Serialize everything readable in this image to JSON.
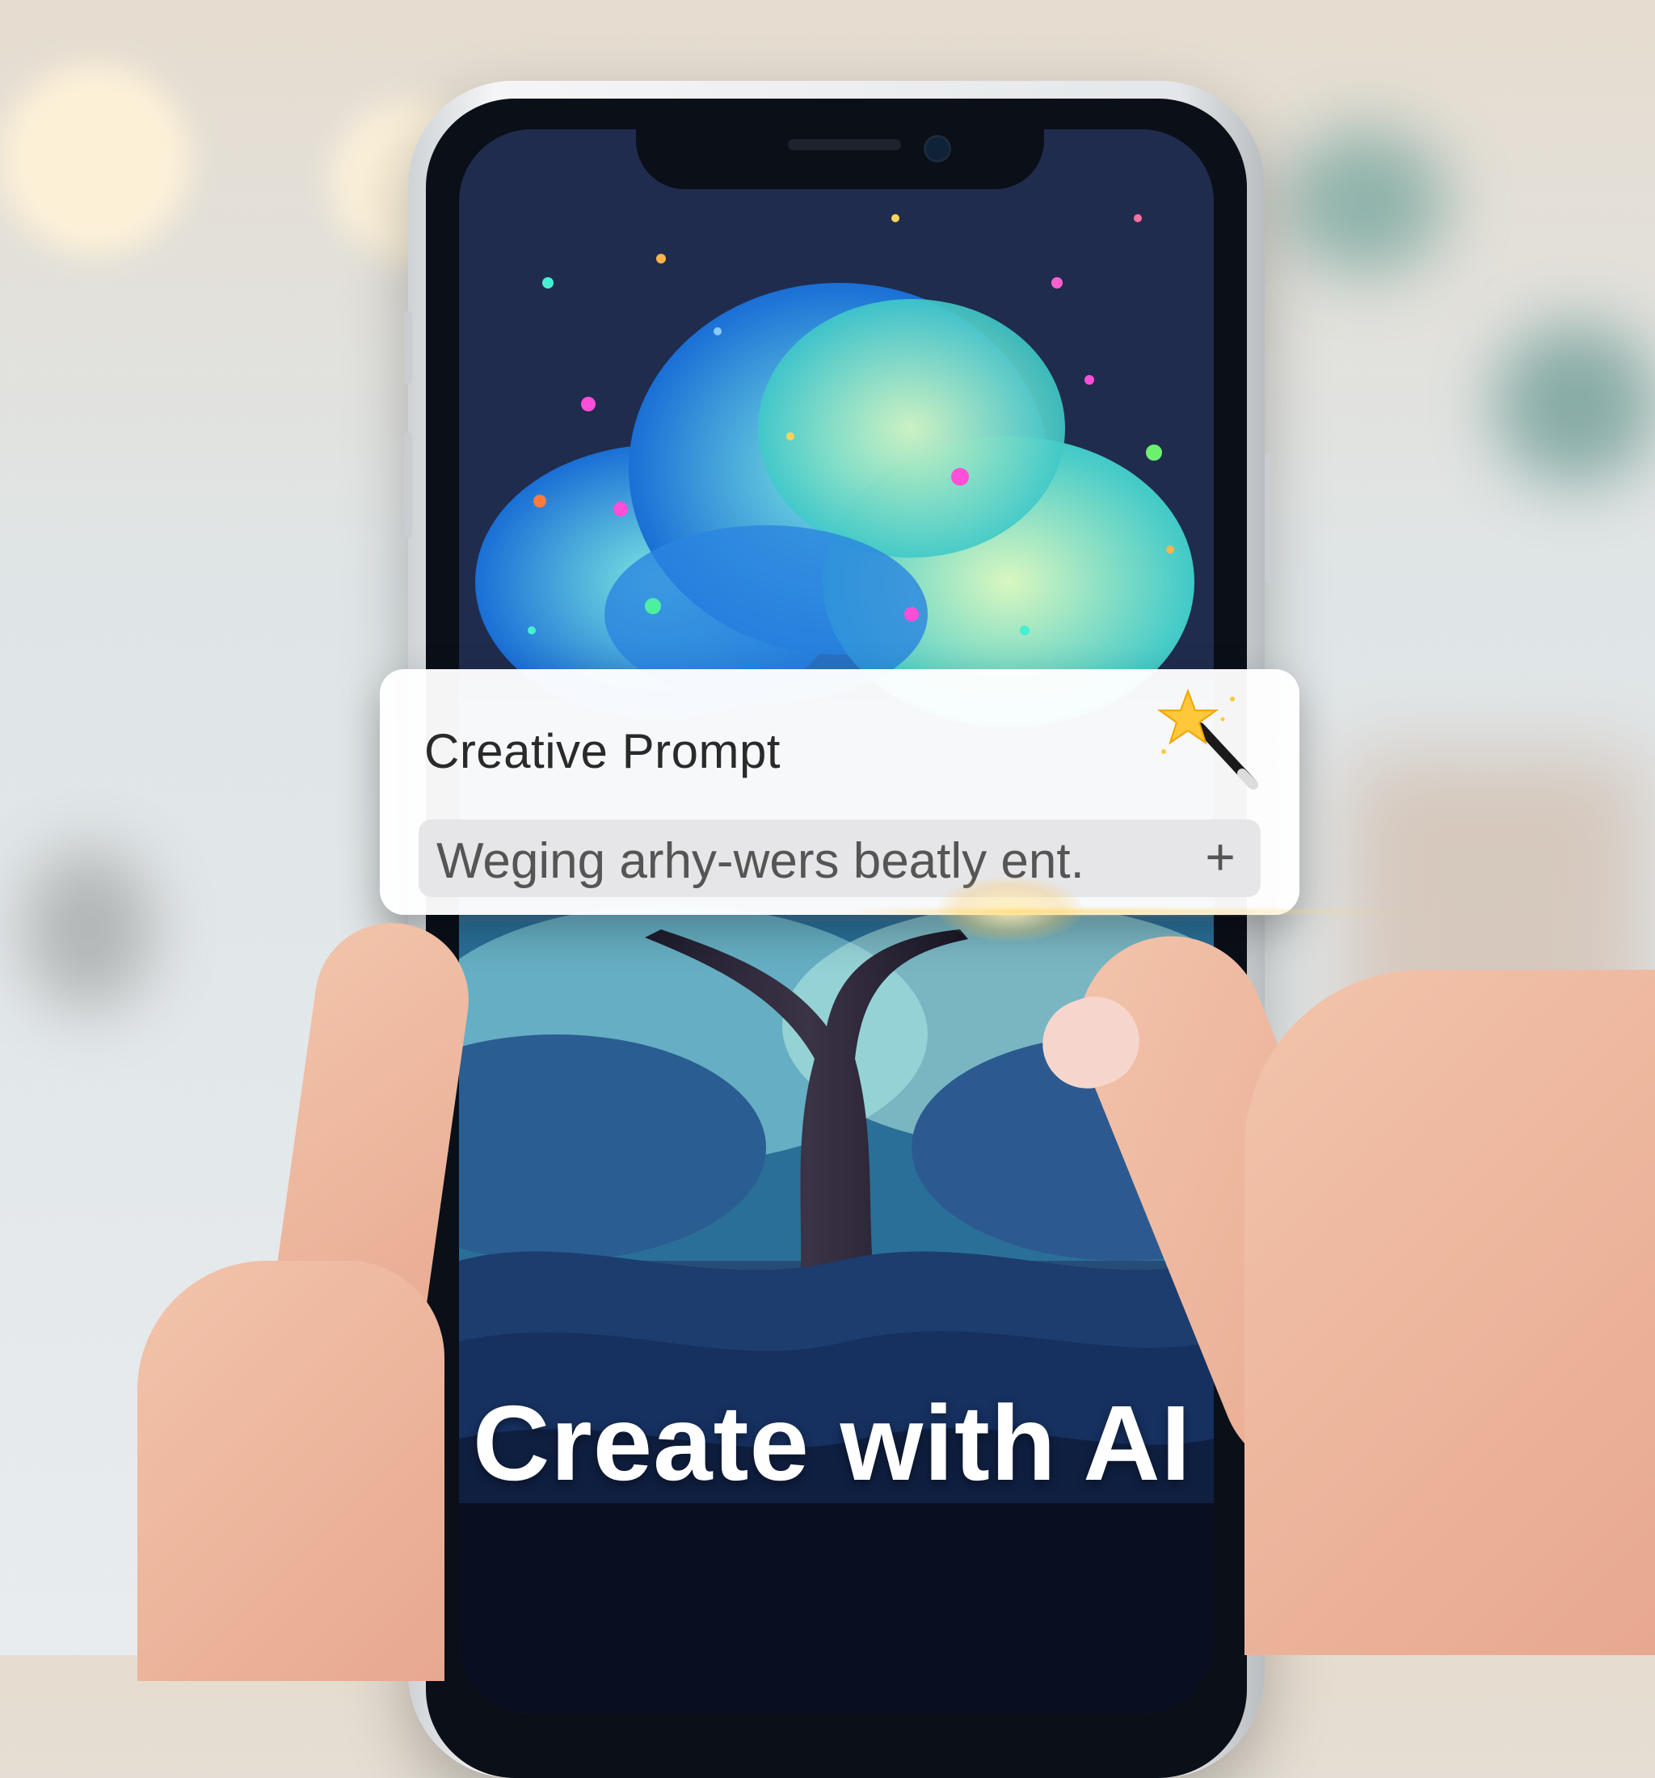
{
  "prompt_card": {
    "title": "Creative Prompt",
    "input_value": "Weging arhy-wers beatly ent.",
    "add_label": "+"
  },
  "headline": "Create with AI",
  "icons": {
    "wand": "magic-wand-icon",
    "add": "plus-icon"
  },
  "colors": {
    "canopy_blue": "#1f7fe0",
    "canopy_cyan": "#3fd6e6",
    "canopy_mint": "#b8f2c6",
    "screen_dark": "#0a1020",
    "headline_text": "#ffffff",
    "glow": "#ffd978"
  }
}
